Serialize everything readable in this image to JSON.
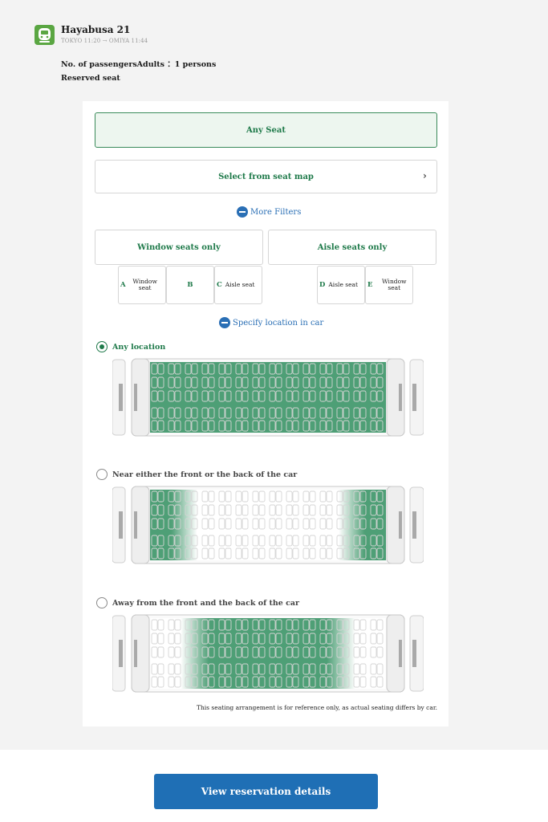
{
  "train": {
    "name": "Hayabusa 21",
    "route": "TOKYO 11:20 → OMIYA 11:44",
    "passengers": "No. of passengersAdults ：1 persons",
    "reserved": "Reserved seat"
  },
  "options": {
    "any_seat": "Any Seat",
    "seat_map": "Select from seat map",
    "seat_map_chevron": "›"
  },
  "filters": {
    "more_filters": "More Filters",
    "window_only": "Window seats only",
    "aisle_only": "Aisle seats only",
    "seats": [
      {
        "letter": "A",
        "label": "Window seat"
      },
      {
        "letter": "B",
        "label": ""
      },
      {
        "letter": "C",
        "label": "Aisle seat"
      },
      {
        "letter": "D",
        "label": "Aisle seat"
      },
      {
        "letter": "E",
        "label": "Window seat"
      }
    ]
  },
  "location": {
    "toggle": "Specify location in car",
    "choices": [
      {
        "label": "Any location",
        "selected": true,
        "mode": "all"
      },
      {
        "label": "Near either the front or the back of the car",
        "selected": false,
        "mode": "ends"
      },
      {
        "label": "Away from the front and the back of the car",
        "selected": false,
        "mode": "middle"
      }
    ],
    "note": "This seating arrangement is for reference only, as actual seating differs by car."
  },
  "footer": {
    "view_details": "View reservation details"
  },
  "colors": {
    "accent_green": "#1f7a4a",
    "seat_green": "#4e9f76",
    "primary_blue": "#1f6fb5"
  }
}
